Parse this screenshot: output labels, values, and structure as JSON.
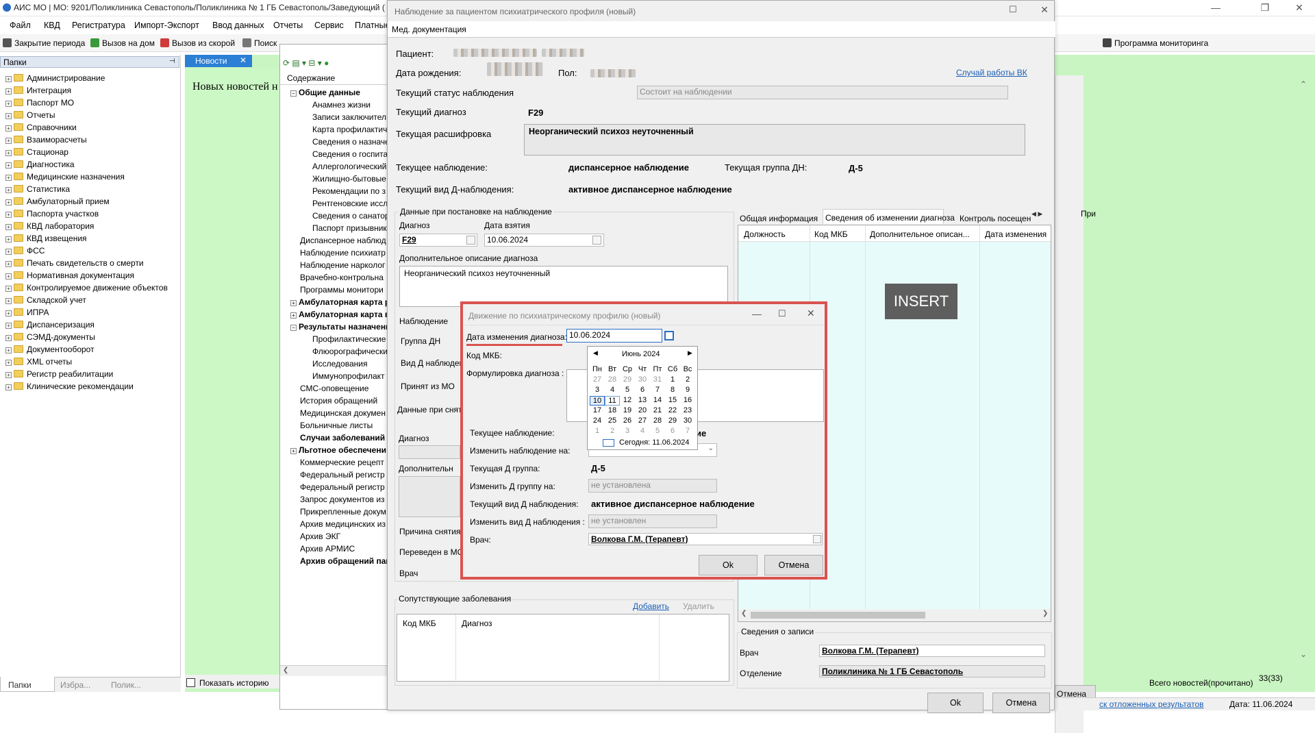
{
  "window": {
    "title": "АИС МО | МО: 9201/Поликлиника Севастополь/Поликлиника № 1 ГБ Севастополь/Заведующий ("
  },
  "menu": [
    "Файл",
    "КВД",
    "Регистратура",
    "Импорт-Экспорт",
    "Ввод данных",
    "Отчеты",
    "Сервис",
    "Платные"
  ],
  "toolbar": {
    "items": [
      "Закрытие периода",
      "Вызов на дом",
      "Вызов из скорой",
      "Поиск"
    ],
    "right": "Программа мониторинга"
  },
  "left_panel": {
    "header": "Папки",
    "items": [
      "Администрирование",
      "Интеграция",
      "Паспорт МО",
      "Отчеты",
      "Справочники",
      "Взаиморасчеты",
      "Стационар",
      "Диагностика",
      "Медицинские назначения",
      "Статистика",
      "Амбулаторный прием",
      "Паспорта участков",
      "КВД лаборатория",
      "КВД извещения",
      "ФСС",
      "Печать свидетельств о смерти",
      "Нормативная документация",
      "Контролируемое движение объектов",
      "Складской учет",
      "ИПРА",
      "Диспансеризация",
      "СЭМД-документы",
      "Документооборот",
      "XML отчеты",
      "Регистр реабилитации",
      "Клинические рекомендации"
    ],
    "tabs": [
      "Папки",
      "Избра...",
      "Полик..."
    ]
  },
  "news": {
    "tab": "Новости",
    "text": "Новых новостей н",
    "show_history": "Показать историю",
    "total": "Всего новостей(прочитано)",
    "count": "33(33)",
    "cancel_tail": "Отмена",
    "footer_link": "ск отложенных результатов",
    "date": "Дата: 11.06.2024"
  },
  "content_tree": {
    "header": "Содержание",
    "items": [
      {
        "t": "Общие данные",
        "b": true,
        "ind": 0,
        "exp": "-"
      },
      {
        "t": "Анамнез жизни",
        "ind": 2
      },
      {
        "t": "Записи заключител",
        "ind": 2
      },
      {
        "t": "Карта профилактич",
        "ind": 2
      },
      {
        "t": "Сведения о назначе",
        "ind": 2
      },
      {
        "t": "Сведения о госпита",
        "ind": 2
      },
      {
        "t": "Аллергологический",
        "ind": 2
      },
      {
        "t": "Жилищно-бытовые",
        "ind": 2
      },
      {
        "t": "Рекомендации по з",
        "ind": 2
      },
      {
        "t": "Рентгеновские иссл",
        "ind": 2
      },
      {
        "t": "Сведения о санатор",
        "ind": 2
      },
      {
        "t": "Паспорт призывник",
        "ind": 2
      },
      {
        "t": "Диспансерное наблюд",
        "ind": 1
      },
      {
        "t": "Наблюдение психиатр",
        "ind": 1
      },
      {
        "t": "Наблюдение нарколог",
        "ind": 1
      },
      {
        "t": "Врачебно-контрольна",
        "ind": 1
      },
      {
        "t": "Программы монитори",
        "ind": 1
      },
      {
        "t": "Амбулаторная карта р",
        "b": true,
        "ind": 0,
        "exp": "+"
      },
      {
        "t": "Амбулаторная карта в",
        "b": true,
        "ind": 0,
        "exp": "+"
      },
      {
        "t": "Результаты назначени",
        "b": true,
        "ind": 0,
        "exp": "-"
      },
      {
        "t": "Профилактические",
        "ind": 2
      },
      {
        "t": "Флюорографически",
        "ind": 2
      },
      {
        "t": "Исследования",
        "ind": 2
      },
      {
        "t": "Иммунопрофилакт",
        "ind": 2
      },
      {
        "t": "СМС-оповещение",
        "ind": 1
      },
      {
        "t": "История обращений",
        "ind": 1
      },
      {
        "t": "Медицинская докумен",
        "ind": 1
      },
      {
        "t": "Больничные листы",
        "ind": 1
      },
      {
        "t": "Случаи заболеваний",
        "b": true,
        "ind": 1
      },
      {
        "t": "Льготное обеспечени",
        "b": true,
        "ind": 0,
        "exp": "+"
      },
      {
        "t": "Коммерческие рецепт",
        "ind": 1
      },
      {
        "t": "Федеральный регистр",
        "ind": 1
      },
      {
        "t": "Федеральный регистр",
        "ind": 1
      },
      {
        "t": "Запрос документов из",
        "ind": 1
      },
      {
        "t": "Прикрепленные докум",
        "ind": 1
      },
      {
        "t": "Архив медицинских из",
        "ind": 1
      },
      {
        "t": "Архив ЭКГ",
        "ind": 1
      },
      {
        "t": "Архив АРМИС",
        "ind": 1
      },
      {
        "t": "Архив обращений паци",
        "b": true,
        "ind": 1
      }
    ]
  },
  "d1": {
    "title": "Наблюдение за пациентом психиатрического профиля (новый)",
    "tab": "Мед. документация",
    "patient_label": "Пациент:",
    "dob_label": "Дата рождения:",
    "sex_label": "Пол:",
    "vk_link": "Случай работы ВК",
    "status_label": "Текущий статус наблюдения",
    "status_value": "Состоит на наблюдении",
    "diag_label": "Текущий диагноз",
    "diag_value": "F29",
    "decode_label": "Текущая расшифровка",
    "decode_value": "Неорганический психоз неуточненный",
    "obs_label": "Текущее наблюдение:",
    "obs_value": "диспансерное наблюдение",
    "group_label": "Текущая группа ДН:",
    "group_value": "Д-5",
    "kind_label": "Текущий вид Д-наблюдения:",
    "kind_value": "активное диспансерное наблюдение",
    "reg_group": "Данные при постановке на наблюдение",
    "reg_diag_label": "Диагноз",
    "reg_diag_value": "F29",
    "reg_date_label": "Дата взятия",
    "reg_date_value": "10.06.2024",
    "reg_extra_label": "Дополнительное описание диагноза",
    "reg_extra_value": "Неорганический психоз неуточненный",
    "l_obs": "Наблюдение",
    "l_grp": "Группа ДН",
    "l_kind": "Вид Д наблюдения",
    "l_from": "Принят из МО",
    "rm_group": "Данные при снят",
    "rm_diag": "Диагноз",
    "rm_extra": "Дополнительн",
    "rm_reason": "Причина снятия",
    "rm_moved": "Переведен в МО",
    "rm_doc": "Врач",
    "co_group": "Сопутствующие заболевания",
    "co_add": "Добавить",
    "co_del": "Удалить",
    "co_cols": [
      "Код МКБ",
      "Диагноз"
    ],
    "rtabs": [
      "Общая информация",
      "Сведения об изменении диагноза",
      "Контроль посещен"
    ],
    "rcols": [
      "Должность",
      "Код МКБ",
      "Дополнительное описан...",
      "Дата изменения"
    ],
    "rec_group": "Сведения о записи",
    "rec_doc_label": "Врач",
    "rec_doc": "Волкова Г.М. (Терапевт)",
    "rec_dept_label": "Отделение",
    "rec_dept": "Поликлиника № 1 ГБ Севастополь",
    "ok": "Ok",
    "cancel": "Отмена",
    "pri": "При"
  },
  "d2": {
    "title": "Движение по психиатрическому профилю (новый)",
    "date_label": "Дата изменения диагноза:",
    "date_value": "10.06.2024",
    "mkb_label": "Код МКБ:",
    "form_label": "Формулировка диагноза :",
    "obs_label": "Текущее наблюдение:",
    "obs_tail": "ие",
    "chg_obs_label": "Изменить наблюдение на:",
    "grp_label": "Текущая Д группа:",
    "grp_value": "Д-5",
    "chg_grp_label": "Изменить Д группу на:",
    "chg_grp_value": "не установлена",
    "kind_label": "Текущий вид Д наблюдения:",
    "kind_value": "активное диспансерное наблюдение",
    "chg_kind_label": "Изменить вид Д наблюдения :",
    "chg_kind_value": "не установлен",
    "doc_label": "Врач:",
    "doc_value": "Волкова Г.М. (Терапевт)",
    "ok": "Ok",
    "cancel": "Отмена"
  },
  "calendar": {
    "month": "Июнь 2024",
    "weekdays": [
      "Пн",
      "Вт",
      "Ср",
      "Чт",
      "Пт",
      "Сб",
      "Вс"
    ],
    "days": [
      [
        "27",
        "28",
        "29",
        "30",
        "31",
        "1",
        "2"
      ],
      [
        "3",
        "4",
        "5",
        "6",
        "7",
        "8",
        "9"
      ],
      [
        "10",
        "11",
        "12",
        "13",
        "14",
        "15",
        "16"
      ],
      [
        "17",
        "18",
        "19",
        "20",
        "21",
        "22",
        "23"
      ],
      [
        "24",
        "25",
        "26",
        "27",
        "28",
        "29",
        "30"
      ],
      [
        "1",
        "2",
        "3",
        "4",
        "5",
        "6",
        "7"
      ]
    ],
    "today": "Сегодня: 11.06.2024"
  },
  "overlay": "INSERT"
}
